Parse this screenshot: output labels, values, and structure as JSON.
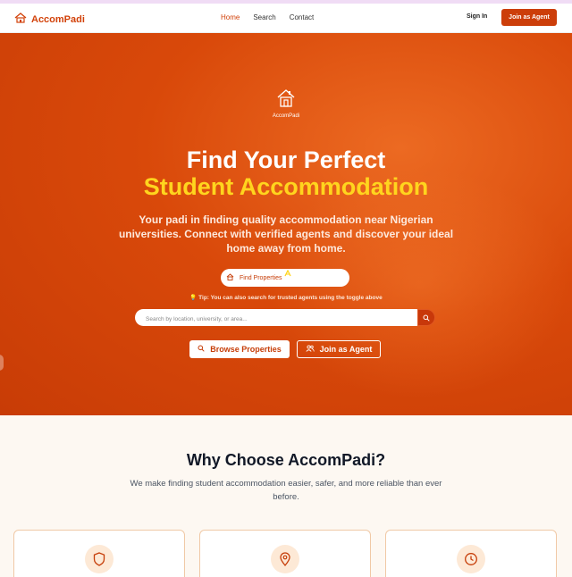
{
  "brand": {
    "name": "AccomPadi",
    "accent": "#d2420a",
    "highlight": "#ffd51e"
  },
  "nav": {
    "links": [
      {
        "label": "Home",
        "active": true
      },
      {
        "label": "Search",
        "active": false
      },
      {
        "label": "Contact",
        "active": false
      }
    ],
    "sign_in": "Sign In",
    "join": "Join as Agent"
  },
  "hero": {
    "logo_label": "AccomPadi",
    "title_line1": "Find Your Perfect",
    "title_line2": "Student Accommodation",
    "subtitle": "Your padi in finding quality accommodation near Nigerian universities. Connect with verified agents and discover your ideal home away from home.",
    "toggle_label": "Find Properties",
    "tip": "💡 Tip: You can also search for trusted agents using the toggle above",
    "search_placeholder": "Search by location, university, or area...",
    "browse_button": "Browse Properties",
    "join_button": "Join as Agent"
  },
  "why": {
    "title": "Why Choose AccomPadi?",
    "subtitle": "We make finding student accommodation easier, safer, and more reliable than ever before.",
    "cards": [
      {
        "icon": "shield-icon"
      },
      {
        "icon": "map-pin-icon"
      },
      {
        "icon": "clock-icon"
      }
    ]
  }
}
